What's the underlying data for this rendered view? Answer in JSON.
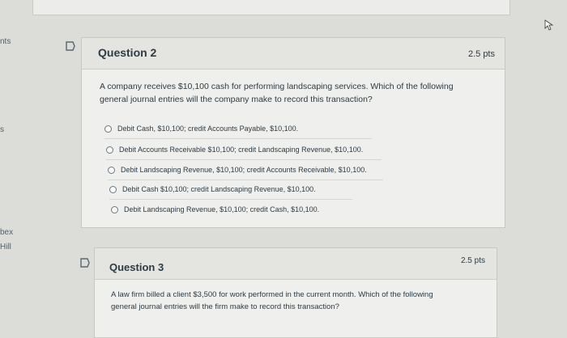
{
  "sidebar": {
    "labels": [
      "nts",
      "s",
      "bex",
      "Hill"
    ]
  },
  "question2": {
    "title": "Question 2",
    "points": "2.5 pts",
    "prompt_line1": "A company receives $10,100 cash for performing landscaping services. Which of the following",
    "prompt_line2": "general journal entries will the company make to record this transaction?",
    "answers": [
      "Debit Cash, $10,100; credit Accounts Payable, $10,100.",
      "Debit Accounts Receivable $10,100; credit Landscaping Revenue, $10,100.",
      "Debit Landscaping Revenue, $10,100; credit Accounts Receivable, $10,100.",
      "Debit Cash $10,100; credit Landscaping Revenue, $10,100.",
      "Debit Landscaping Revenue, $10,100; credit Cash, $10,100."
    ]
  },
  "question3": {
    "title": "Question 3",
    "points": "2.5 pts",
    "prompt_line1": "A law firm billed a client $3,500 for work performed in the current month. Which of the following",
    "prompt_line2": "general journal entries will the firm make to record this transaction?"
  }
}
